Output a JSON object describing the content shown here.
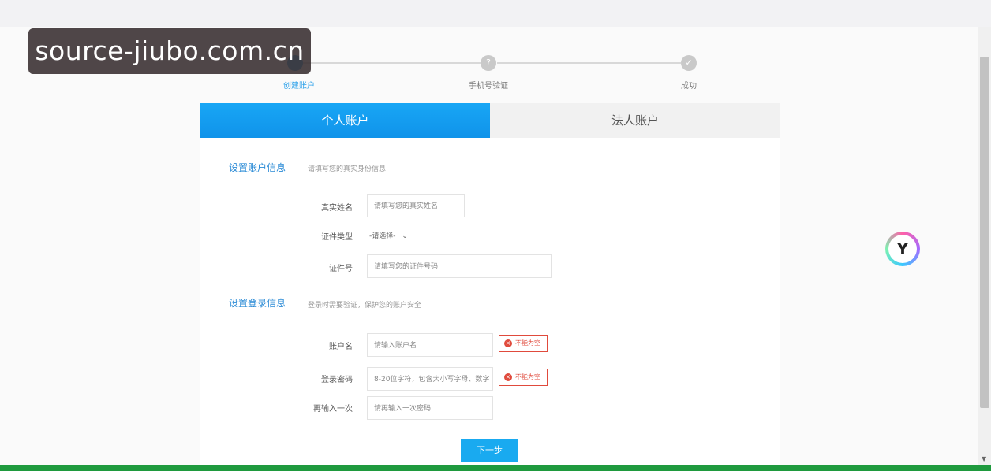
{
  "watermark": "source-jiubo.com.cn",
  "steps": [
    {
      "label": "创建账户",
      "icon": "",
      "active": true
    },
    {
      "label": "手机号验证",
      "icon": "?",
      "active": false
    },
    {
      "label": "成功",
      "icon": "✓",
      "active": false
    }
  ],
  "tabs": {
    "personal": "个人账户",
    "legal": "法人账户"
  },
  "account_section": {
    "title": "设置账户信息",
    "hint": "请填写您的真实身份信息"
  },
  "fields": {
    "real_name": {
      "label": "真实姓名",
      "placeholder": "请填写您的真实姓名"
    },
    "id_type": {
      "label": "证件类型",
      "value": "-请选择-"
    },
    "id_number": {
      "label": "证件号",
      "placeholder": "请填写您的证件号码"
    }
  },
  "login_section": {
    "title": "设置登录信息",
    "hint": "登录时需要验证，保护您的账户安全"
  },
  "login_fields": {
    "username": {
      "label": "账户名",
      "placeholder": "请输入账户名",
      "error": "不能为空"
    },
    "password": {
      "label": "登录密码",
      "placeholder": "8-20位字符，包含大小写字母、数字",
      "error": "不能为空"
    },
    "confirm": {
      "label": "再输入一次",
      "placeholder": "请再输入一次密码"
    }
  },
  "next_button": "下一步",
  "colors": {
    "accent": "#1093ea",
    "error": "#e04a3c",
    "bottom_bar": "#1f9a3e"
  },
  "icons": {
    "error": "close-circle-icon",
    "floating": "assistant-icon",
    "dropdown": "chevron-down-icon"
  }
}
